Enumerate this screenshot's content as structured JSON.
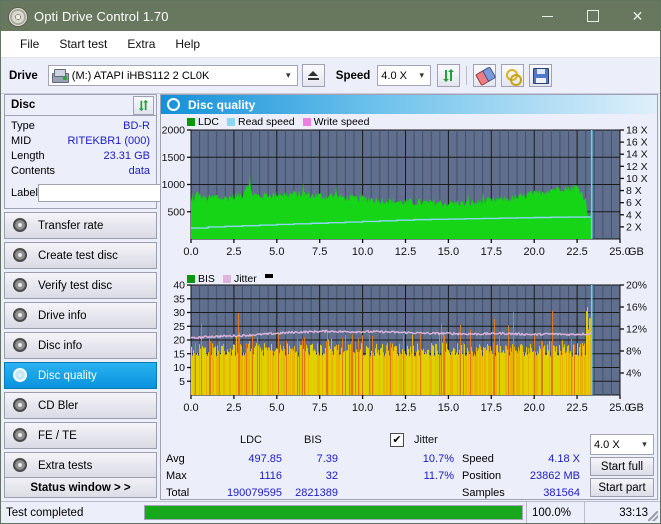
{
  "window": {
    "title": "Opti Drive Control 1.70",
    "icon": "disc-icon",
    "minimize": "–",
    "maximize": "□",
    "close": "✕"
  },
  "menu": {
    "items": [
      "File",
      "Start test",
      "Extra",
      "Help"
    ]
  },
  "toolbar": {
    "drive_label": "Drive",
    "drive_value": "(M:)   ATAPI iHBS112  2 CL0K",
    "eject_title": "Eject",
    "speed_label": "Speed",
    "speed_value": "4.0 X",
    "icons": [
      "refresh-icon",
      "eraser-icon",
      "key-icon",
      "save-icon"
    ]
  },
  "sidebar": {
    "disc_panel": {
      "title": "Disc",
      "refresh_icon": "refresh-icon",
      "rows": [
        {
          "key": "Type",
          "value": "BD-R"
        },
        {
          "key": "MID",
          "value": "RITEKBR1 (000)"
        },
        {
          "key": "Length",
          "value": "23.31 GB"
        },
        {
          "key": "Contents",
          "value": "data"
        }
      ],
      "label_key": "Label",
      "label_value": "",
      "disc_button_icon": "disc-icon"
    },
    "items": [
      {
        "label": "Transfer rate",
        "selected": false
      },
      {
        "label": "Create test disc",
        "selected": false
      },
      {
        "label": "Verify test disc",
        "selected": false
      },
      {
        "label": "Drive info",
        "selected": false
      },
      {
        "label": "Disc info",
        "selected": false
      },
      {
        "label": "Disc quality",
        "selected": true
      },
      {
        "label": "CD Bler",
        "selected": false
      },
      {
        "label": "FE / TE",
        "selected": false
      },
      {
        "label": "Extra tests",
        "selected": false
      }
    ],
    "status_window": "Status window > >"
  },
  "main": {
    "title": "Disc quality",
    "icon": "disc-quality-icon"
  },
  "stats": {
    "col_ldc": "LDC",
    "col_bis": "BIS",
    "row_avg": "Avg",
    "row_max": "Max",
    "row_total": "Total",
    "avg_ldc": "497.85",
    "avg_bis": "7.39",
    "max_ldc": "1116",
    "max_bis": "32",
    "total_ldc": "190079595",
    "total_bis": "2821389",
    "jitter_label": "Jitter",
    "jitter_checked": "✔",
    "jitter_avg": "10.7%",
    "jitter_max": "11.7%",
    "speed_label": "Speed",
    "speed_value": "4.18 X",
    "position_label": "Position",
    "position_value": "23862 MB",
    "samples_label": "Samples",
    "samples_value": "381564",
    "speed_select": "4.0 X",
    "start_full": "Start full",
    "start_part": "Start part"
  },
  "statusbar": {
    "message": "Test completed",
    "percent": "100.0%",
    "progress_value": 100,
    "time": "33:13"
  },
  "colors": {
    "titlebar": "#67785f",
    "ldc_green": "#16d416",
    "read_speed_cyan": "#8ad8f2",
    "write_speed_pink": "#f07de0",
    "bis_yellow": "#e8c800",
    "jitter_pink": "#dcb4dc",
    "plot_bg": "#5f6f8d",
    "accent_blue": "#1b1bc9",
    "selected_nav": "#0a93dd",
    "progress_green": "#18a71c"
  },
  "chart_data": [
    {
      "type": "area",
      "name": "disc-quality-ldc-chart",
      "title": "",
      "legend": [
        {
          "label": "LDC",
          "color": "#089808"
        },
        {
          "label": "Read speed",
          "color": "#8ad8f2"
        },
        {
          "label": "Write speed",
          "color": "#f07de0"
        }
      ],
      "legend_position": "top-left",
      "xlabel": "GB",
      "xlim": [
        0,
        25.0
      ],
      "xticks": [
        "0.0",
        "2.5",
        "5.0",
        "7.5",
        "10.0",
        "12.5",
        "15.0",
        "17.5",
        "20.0",
        "22.5",
        "25.0"
      ],
      "ylabel_left": "",
      "ylim_left": [
        0,
        2000
      ],
      "yticks_left": [
        "2000",
        "1500",
        "1000",
        "500"
      ],
      "ylabel_right": "X",
      "ylim_right": [
        0,
        18
      ],
      "yticks_right": [
        "18 X",
        "16 X",
        "14 X",
        "12 X",
        "10 X",
        "8 X",
        "6 X",
        "4 X",
        "2 X"
      ],
      "grid": true,
      "data_end_gb": 23.35,
      "position_marker_gb": 23.35,
      "series": [
        {
          "name": "LDC",
          "color": "#16d416",
          "x": [
            0.0,
            0.3,
            0.6,
            0.9,
            1.2,
            1.5,
            1.8,
            2.1,
            2.4,
            2.7,
            3.0,
            3.3,
            3.6,
            3.9,
            4.2,
            4.5,
            4.8,
            5.1,
            5.4,
            5.7,
            6.0,
            6.3,
            6.6,
            6.9,
            7.2,
            7.5,
            7.8,
            8.1,
            8.4,
            8.7,
            9.0,
            9.3,
            9.6,
            9.9,
            10.2,
            10.5,
            10.8,
            11.1,
            11.4,
            11.7,
            12.0,
            12.3,
            12.6,
            12.9,
            13.2,
            13.5,
            13.8,
            14.1,
            14.4,
            14.7,
            15.0,
            15.3,
            15.6,
            15.9,
            16.2,
            16.5,
            16.8,
            17.1,
            17.4,
            17.7,
            18.0,
            18.3,
            18.6,
            18.9,
            19.2,
            19.5,
            19.8,
            20.1,
            20.4,
            20.7,
            21.0,
            21.3,
            21.6,
            21.9,
            22.2,
            22.5,
            22.8,
            23.1,
            23.35
          ],
          "values": [
            700,
            980,
            830,
            800,
            820,
            840,
            800,
            810,
            840,
            860,
            870,
            1116,
            880,
            850,
            860,
            880,
            860,
            900,
            880,
            870,
            900,
            880,
            890,
            870,
            860,
            850,
            840,
            860,
            830,
            840,
            820,
            810,
            800,
            820,
            800,
            790,
            780,
            770,
            760,
            750,
            740,
            730,
            740,
            720,
            730,
            720,
            710,
            730,
            720,
            710,
            700,
            710,
            720,
            700,
            710,
            720,
            730,
            740,
            750,
            760,
            780,
            800,
            790,
            810,
            830,
            860,
            900,
            880,
            920,
            950,
            980,
            1000,
            1020,
            1000,
            1010,
            1030,
            900,
            700,
            680
          ]
        },
        {
          "name": "Read speed",
          "color": "#8ad8f2",
          "x": [
            0.0,
            1.0,
            2.0,
            3.0,
            4.0,
            5.0,
            6.0,
            7.0,
            8.0,
            9.0,
            10.0,
            11.0,
            12.0,
            13.0,
            14.0,
            15.0,
            16.0,
            17.0,
            18.0,
            19.0,
            20.0,
            21.0,
            22.0,
            23.0,
            23.35
          ],
          "values": [
            1.8,
            2.0,
            2.1,
            2.2,
            2.3,
            2.4,
            2.5,
            2.6,
            2.7,
            2.8,
            2.9,
            3.0,
            3.1,
            3.2,
            3.25,
            3.3,
            3.35,
            3.4,
            3.45,
            3.5,
            3.55,
            3.6,
            3.62,
            3.65,
            3.65
          ]
        }
      ]
    },
    {
      "type": "bar",
      "name": "disc-quality-bis-chart",
      "title": "",
      "legend": [
        {
          "label": "BIS",
          "color": "#089808"
        },
        {
          "label": "Jitter",
          "color": "#dcb4dc"
        }
      ],
      "legend_position": "top-left",
      "xlabel": "GB",
      "xlim": [
        0,
        25.0
      ],
      "xticks": [
        "0.0",
        "2.5",
        "5.0",
        "7.5",
        "10.0",
        "12.5",
        "15.0",
        "17.5",
        "20.0",
        "22.5",
        "25.0"
      ],
      "ylim_left": [
        0,
        40
      ],
      "yticks_left": [
        "40",
        "35",
        "30",
        "25",
        "20",
        "15",
        "10",
        "5"
      ],
      "ylim_right": [
        0,
        20
      ],
      "yticks_right": [
        "20%",
        "16%",
        "12%",
        "8%",
        "4%"
      ],
      "grid": true,
      "data_end_gb": 23.35,
      "position_marker_gb": 23.35,
      "series": [
        {
          "name": "BIS",
          "color": "#e8c800",
          "note": "dense vertical bars averaging ~7.4, peaks to 32"
        },
        {
          "name": "Jitter",
          "color": "#dcb4dc",
          "x": [
            0.0,
            1.0,
            2.0,
            3.0,
            4.0,
            5.0,
            6.0,
            7.0,
            8.0,
            9.0,
            10.0,
            11.0,
            12.0,
            13.0,
            14.0,
            15.0,
            16.0,
            17.0,
            18.0,
            19.0,
            20.0,
            21.0,
            22.0,
            23.0,
            23.35
          ],
          "values": [
            10.3,
            10.6,
            10.7,
            10.8,
            11.0,
            11.2,
            11.4,
            11.5,
            11.6,
            11.5,
            11.5,
            11.5,
            11.4,
            11.3,
            11.2,
            11.2,
            11.1,
            11.1,
            11.2,
            11.1,
            11.0,
            11.1,
            11.0,
            11.1,
            11.2
          ]
        }
      ]
    }
  ]
}
